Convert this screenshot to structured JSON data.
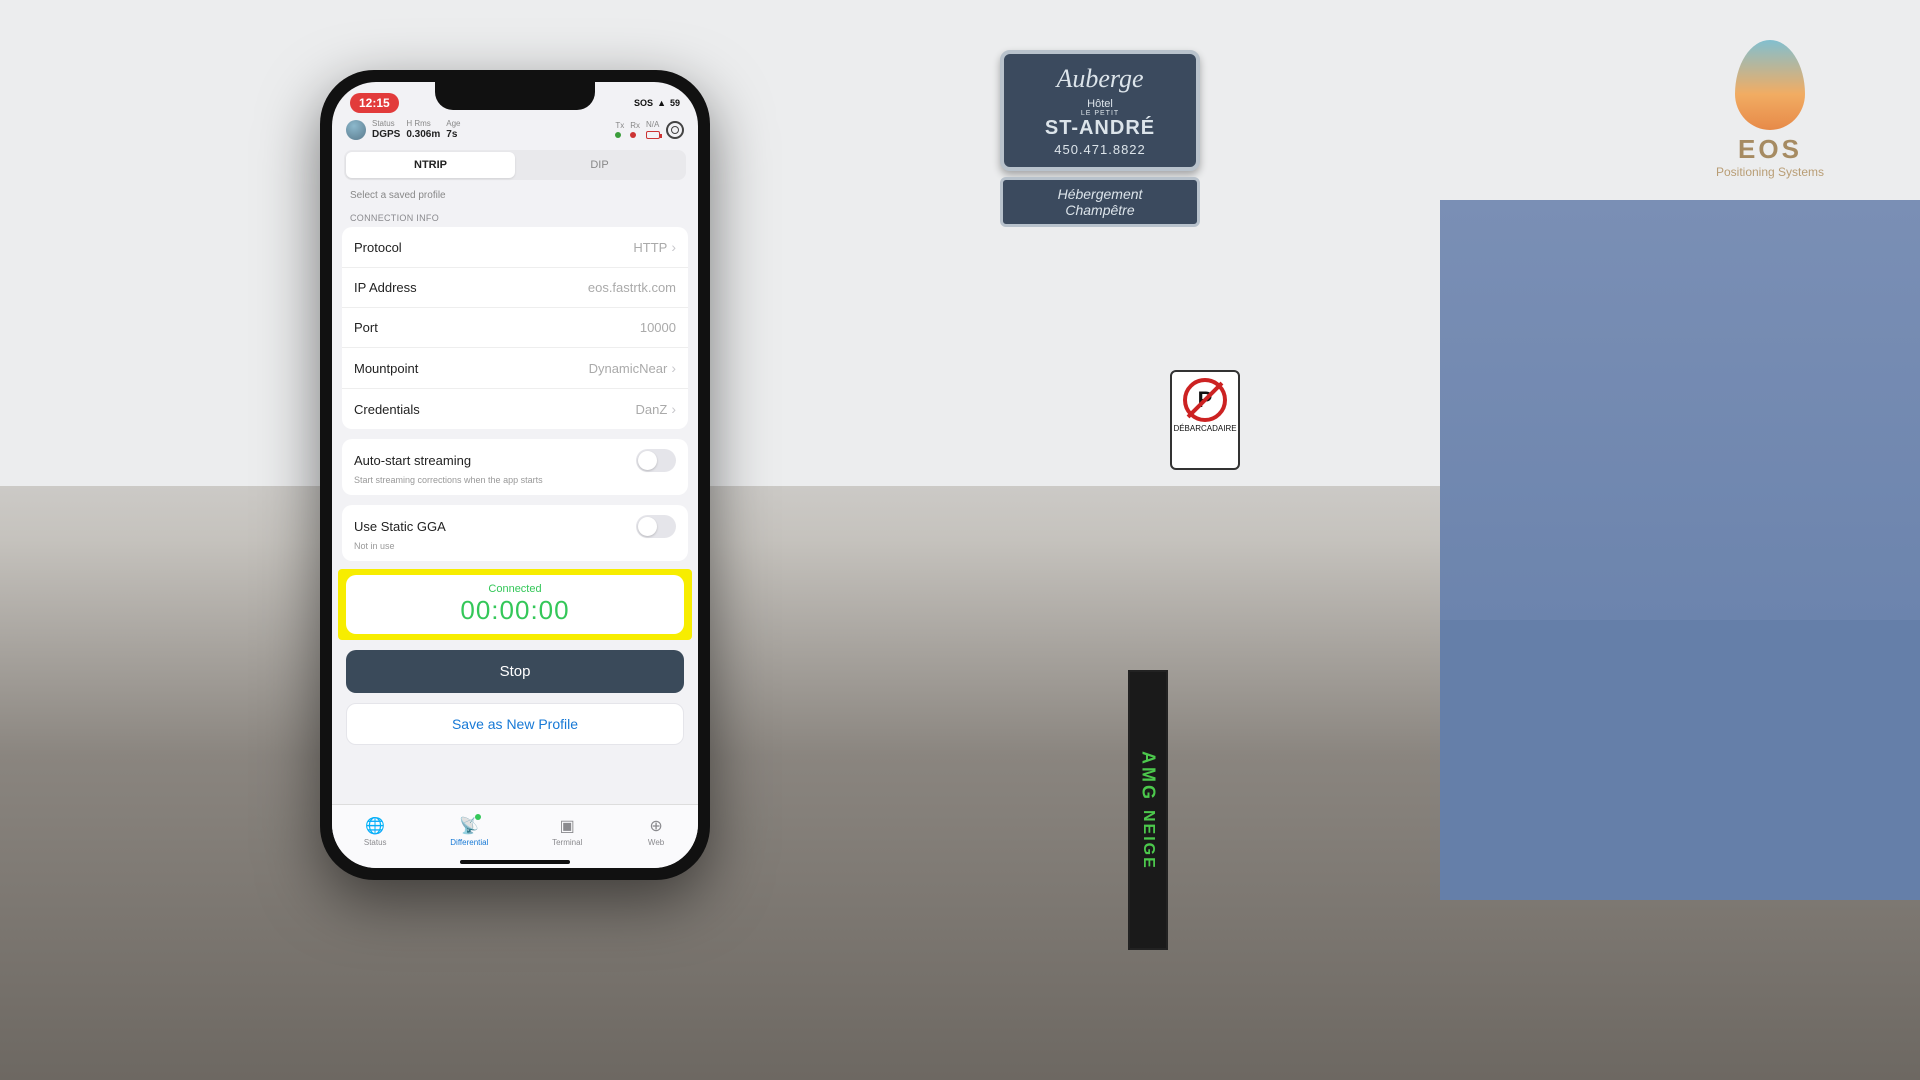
{
  "logo": {
    "name": "EOS",
    "sub": "Positioning Systems"
  },
  "sign": {
    "top": "Auberge",
    "hotel": "Hôtel",
    "petit": "LE PETIT",
    "name": "ST-ANDRÉ",
    "phone": "450.471.8822",
    "lower1": "Hébergement",
    "lower2": "Champêtre"
  },
  "parking": {
    "letter": "P",
    "label": "DÉBARCADAIRE"
  },
  "amg": {
    "t1": "AMG",
    "t2": "NEIGE"
  },
  "phone": {
    "status_bar": {
      "time": "12:15",
      "sos": "SOS",
      "batt": "59"
    },
    "header": {
      "status_lab": "Status",
      "status_val": "DGPS",
      "hrms_lab": "H Rms",
      "hrms_val": "0.306m",
      "age_lab": "Age",
      "age_val": "7s",
      "tx": "Tx",
      "rx": "Rx",
      "na": "N/A"
    },
    "tabs": {
      "ntrip": "NTRIP",
      "dip": "DIP"
    },
    "hint": "Select a saved profile",
    "section_conn": "CONNECTION INFO",
    "rows": {
      "protocol_k": "Protocol",
      "protocol_v": "HTTP",
      "ip_k": "IP Address",
      "ip_v": "eos.fastrtk.com",
      "port_k": "Port",
      "port_v": "10000",
      "mount_k": "Mountpoint",
      "mount_v": "DynamicNear",
      "cred_k": "Credentials",
      "cred_v": "DanZ"
    },
    "autostart": {
      "label": "Auto-start streaming",
      "sub": "Start streaming corrections when the app starts"
    },
    "staticgga": {
      "label": "Use Static GGA",
      "sub": "Not in use"
    },
    "connection": {
      "status": "Connected",
      "timer": "00:00:00"
    },
    "stop": "Stop",
    "save_profile": "Save as New Profile",
    "tabbar": {
      "status": "Status",
      "diff": "Differential",
      "term": "Terminal",
      "web": "Web"
    }
  }
}
